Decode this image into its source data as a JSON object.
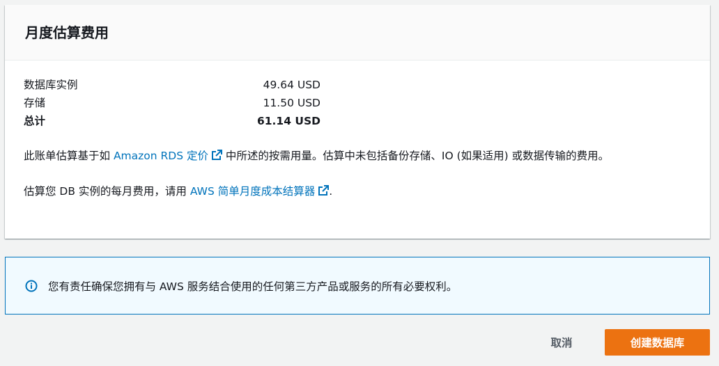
{
  "card": {
    "title": "月度估算费用",
    "costs": [
      {
        "label": "数据库实例",
        "value": "49.64 USD"
      },
      {
        "label": "存储",
        "value": "11.50 USD"
      }
    ],
    "total": {
      "label": "总计",
      "value": "61.14 USD"
    },
    "para1": {
      "before": "此账单估算基于如 ",
      "link": "Amazon RDS 定价",
      "after": " 中所述的按需用量。估算中未包括备份存储、IO (如果适用) 或数据传输的费用。"
    },
    "para2": {
      "before": "估算您 DB 实例的每月费用，请用 ",
      "link": "AWS 简单月度成本结算器",
      "after": "."
    }
  },
  "info": {
    "icon": "info-icon",
    "text": "您有责任确保您拥有与 AWS 服务结合使用的任何第三方产品或服务的所有必要权利。"
  },
  "actions": {
    "cancel_label": "取消",
    "create_label": "创建数据库"
  },
  "colors": {
    "accent": "#ec7211",
    "link": "#0073bb",
    "info_border": "#0073bb",
    "info_bg": "#f1faff"
  }
}
